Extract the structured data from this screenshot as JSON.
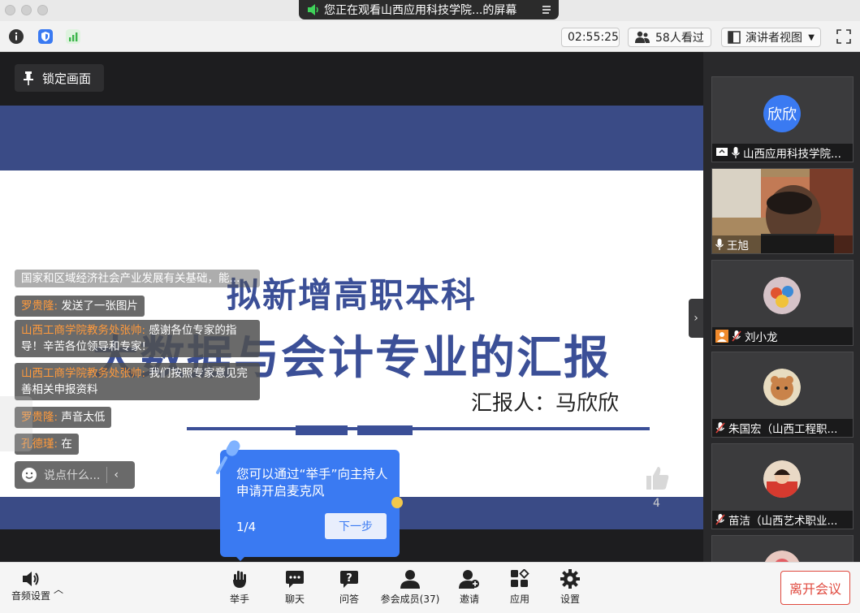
{
  "window": {
    "banner_text": "您正在观看山西应用科技学院...的屏幕"
  },
  "toolbar": {
    "timer": "02:55:25",
    "viewers": "58人看过",
    "view_mode": "演讲者视图"
  },
  "stage": {
    "lock_label": "锁定画面",
    "slide": {
      "title_line1": "拟新增高职本科",
      "title_line2": "大数据与会计专业的汇报",
      "reporter": "汇报人：马欣欣"
    },
    "chat": [
      {
        "who": "",
        "text": "国家和区域经济社会产业发展有关基础，能..."
      },
      {
        "who": "罗贵隆:",
        "text": " 发送了一张图片"
      },
      {
        "who": "山西工商学院教务处张帅:",
        "text": " 感谢各位专家的指导！辛苦各位领导和专家!"
      },
      {
        "who": "山西工商学院教务处张帅:",
        "text": " 我们按照专家意见完善相关申报资料"
      },
      {
        "who": "罗贵隆:",
        "text": " 声音太低"
      },
      {
        "who": "孔德瑾:",
        "text": " 在"
      }
    ],
    "chat_placeholder": "说点什么...",
    "tip": {
      "text": "您可以通过“举手”向主持人申请开启麦克风",
      "step": "1/4",
      "next_label": "下一步"
    },
    "like_count": "4"
  },
  "participants": [
    {
      "name": "山西应用科技学院...",
      "avatar_text": "欣欣",
      "kind": "text"
    },
    {
      "name": "王旭",
      "kind": "video"
    },
    {
      "name": "刘小龙",
      "kind": "image"
    },
    {
      "name": "朱国宏（山西工程职...",
      "kind": "image"
    },
    {
      "name": "苗洁（山西艺术职业...",
      "kind": "image"
    }
  ],
  "bottom": {
    "audio_settings": "音频设置",
    "items": [
      "举手",
      "聊天",
      "问答",
      "参会成员(37)",
      "邀请",
      "应用",
      "设置"
    ],
    "leave_label": "离开会议"
  },
  "colors": {
    "accent": "#3a7af2",
    "slide_blue": "#3b4f97",
    "leave_red": "#e04a3f",
    "chat_name": "#ff9a3c"
  }
}
